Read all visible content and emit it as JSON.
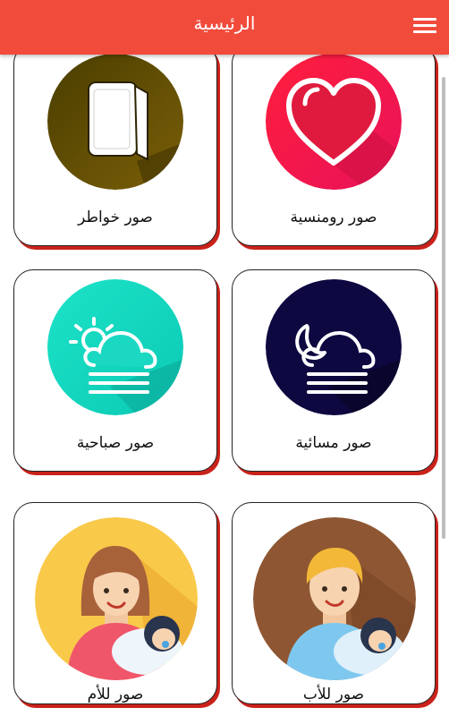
{
  "header": {
    "title": "الرئيسية",
    "menu_icon": "hamburger-icon"
  },
  "cards": [
    {
      "label": "صور رومنسية",
      "icon": "heart-icon",
      "bg": "#f0143f"
    },
    {
      "label": "صور خواطر",
      "icon": "book-icon",
      "bg": "#5a4a00"
    },
    {
      "label": "صور مسائية",
      "icon": "night-cloud-icon",
      "bg": "#0d0840"
    },
    {
      "label": "صور صباحية",
      "icon": "sun-cloud-icon",
      "bg": "#14d6c0"
    },
    {
      "label": "صور للأب",
      "icon": "father-baby-icon",
      "bg": "#8e5632"
    },
    {
      "label": "صور للأم",
      "icon": "mother-baby-icon",
      "bg": "#f9c94a"
    }
  ],
  "colors": {
    "header": "#f14b3c",
    "card_shadow": "#c9221a"
  }
}
